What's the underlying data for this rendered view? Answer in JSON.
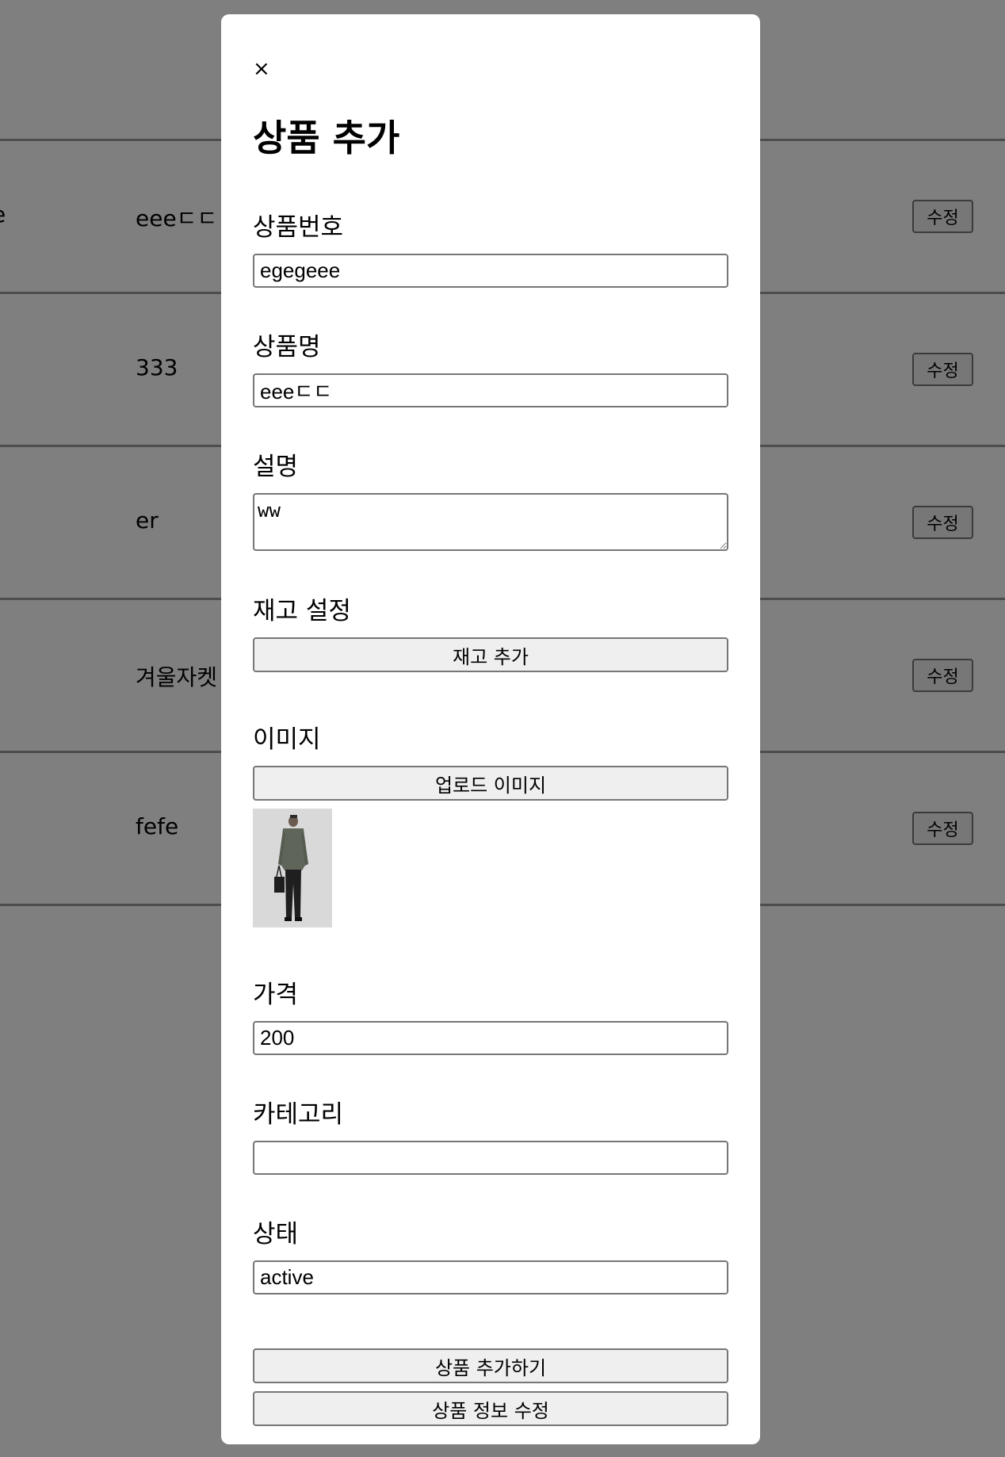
{
  "background": {
    "rows": [
      {
        "lead": "e",
        "name": "eeeㄷㄷ",
        "edit_label": "수정"
      },
      {
        "lead": "",
        "name": "333",
        "edit_label": "수정"
      },
      {
        "lead": "",
        "name": "er",
        "edit_label": "수정"
      },
      {
        "lead": "",
        "name": "겨울자켓",
        "edit_label": "수정"
      },
      {
        "lead": "",
        "name": "fefe",
        "edit_label": "수정"
      }
    ]
  },
  "modal": {
    "close_label": "×",
    "title": "상품 추가",
    "fields": {
      "product_number": {
        "label": "상품번호",
        "value": "egegeee"
      },
      "product_name": {
        "label": "상품명",
        "value": "eeeㄷㄷ"
      },
      "description": {
        "label": "설명",
        "value": "ww"
      },
      "stock": {
        "label": "재고 설정",
        "button_label": "재고 추가"
      },
      "image": {
        "label": "이미지",
        "button_label": "업로드 이미지",
        "thumbnail": "product-photo-man-in-jacket"
      },
      "price": {
        "label": "가격",
        "value": "200"
      },
      "category": {
        "label": "카테고리",
        "value": ""
      },
      "status": {
        "label": "상태",
        "value": "active"
      }
    },
    "actions": {
      "add_label": "상품 추가하기",
      "update_label": "상품 정보 수정"
    }
  },
  "colors": {
    "overlay": "#808080",
    "modal_bg": "#ffffff",
    "button_bg": "#efefef",
    "border": "#767676"
  }
}
